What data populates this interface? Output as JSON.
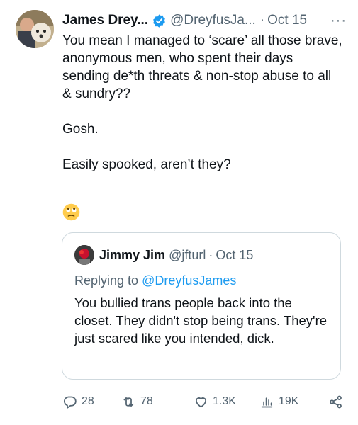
{
  "tweet": {
    "author_name": "James Drey...",
    "author_handle": "@DreyfusJa...",
    "separator": "·",
    "date": "Oct 15",
    "more": "···",
    "body": [
      "You mean I managed to ‘scare’ all those brave, anonymous men, who spent their days sending de*th threats & non-stop abuse to all & sundry??",
      "Gosh.",
      "Easily spooked, aren’t they?"
    ],
    "emoji_icon": "rolling-eyes-emoji"
  },
  "quoted_tweet": {
    "author_name": "Jimmy Jim",
    "author_handle": "@jfturl",
    "separator": "·",
    "date": "Oct 15",
    "replying_prefix": "Replying to ",
    "replying_to": "@DreyfusJames",
    "text": "You bullied trans people back into the closet. They didn't stop being trans. They're just scared like you intended, dick."
  },
  "actions": {
    "replies": "28",
    "retweets": "78",
    "likes": "1.3K",
    "views": "19K"
  },
  "colors": {
    "text": "#0f1419",
    "secondary": "#536471",
    "accent": "#1d9bf0",
    "border": "#cfd9de"
  }
}
